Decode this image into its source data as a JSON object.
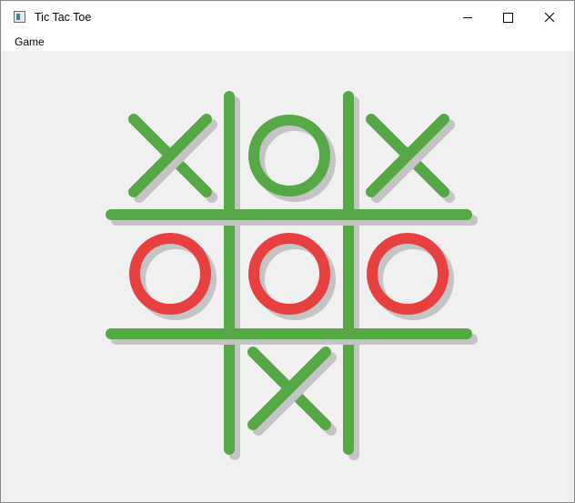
{
  "window": {
    "title": "Tic Tac Toe",
    "icon": "app-window-icon",
    "controls": [
      "minimize-icon",
      "maximize-icon",
      "close-icon"
    ]
  },
  "menu": {
    "items": [
      "Game"
    ]
  },
  "board": {
    "grid_color": "#55a845",
    "shadow_color": "#c4c4c4",
    "x_color": "#55a845",
    "o_winning_color": "#e84040",
    "o_color": "#55a845",
    "background": "#f0f0f0",
    "cells": [
      [
        "X",
        "O",
        "X"
      ],
      [
        "O",
        "O",
        "O"
      ],
      [
        "",
        "X",
        ""
      ]
    ],
    "winning_row": 1
  }
}
